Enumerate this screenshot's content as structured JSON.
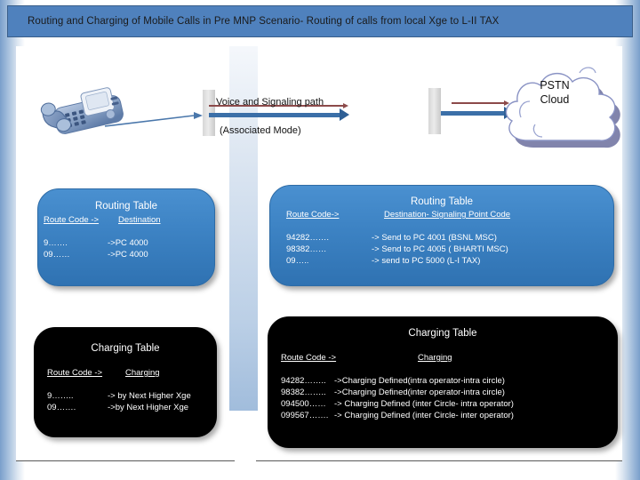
{
  "title_bar": {
    "text": "Routing and Charging of Mobile Calls in Pre MNP Scenario- Routing of calls from local Xge to L-II TAX"
  },
  "diagram": {
    "phone_icon": "telephone-icon",
    "path_label": "Voice and Signaling path",
    "mode_label": "(Associated Mode)",
    "cloud_label": "PSTN\nCloud",
    "cloud_line1": "PSTN",
    "cloud_line2": "Cloud",
    "colors": {
      "title_bar": "#4f81bd",
      "box_blue": "#3d83c4",
      "box_black": "#000000",
      "signaling_line": "#8c4a4a",
      "voice_line": "#3b6fa8"
    }
  },
  "routing_table_left": {
    "title": "Routing Table",
    "header": {
      "col1": "Route Code   ->",
      "col2": "Destination"
    },
    "rows": [
      {
        "code": "9…….",
        "dest": "->PC 4000"
      },
      {
        "code": "09……",
        "dest": "->PC 4000"
      }
    ]
  },
  "routing_table_right": {
    "title": "Routing Table",
    "header": {
      "col1": "Route Code->",
      "col2": "Destination- Signaling  Point Code"
    },
    "rows": [
      {
        "code": "94282…….",
        "dest": "-> Send to PC 4001  (BSNL MSC)"
      },
      {
        "code": "98382……",
        "dest": "-> Send to PC 4005 ( BHARTI MSC)"
      },
      {
        "code": "09…..",
        "dest": "-> send to PC 5000 (L-I TAX)"
      }
    ]
  },
  "charging_table_left": {
    "title": "Charging Table",
    "header": {
      "col1": "Route Code   ->",
      "col2": "Charging"
    },
    "rows": [
      {
        "code": "9……..",
        "charge": "-> by Next Higher Xge"
      },
      {
        "code": "09…….",
        "charge": "->by Next Higher Xge"
      }
    ]
  },
  "charging_table_right": {
    "title": "Charging Table",
    "header": {
      "col1": "Route Code   ->",
      "col2": "Charging"
    },
    "rows": [
      {
        "code": "94282……..",
        "charge": "->Charging  Defined(intra operator-intra circle)"
      },
      {
        "code": "98382……..",
        "charge": "->Charging  Defined(inter operator-intra circle)"
      },
      {
        "code": "094500……",
        "charge": "-> Charging  Defined (inter Circle- intra operator)"
      },
      {
        "code": "099567…….",
        "charge": "-> Charging  Defined (inter Circle- inter operator)"
      }
    ]
  }
}
